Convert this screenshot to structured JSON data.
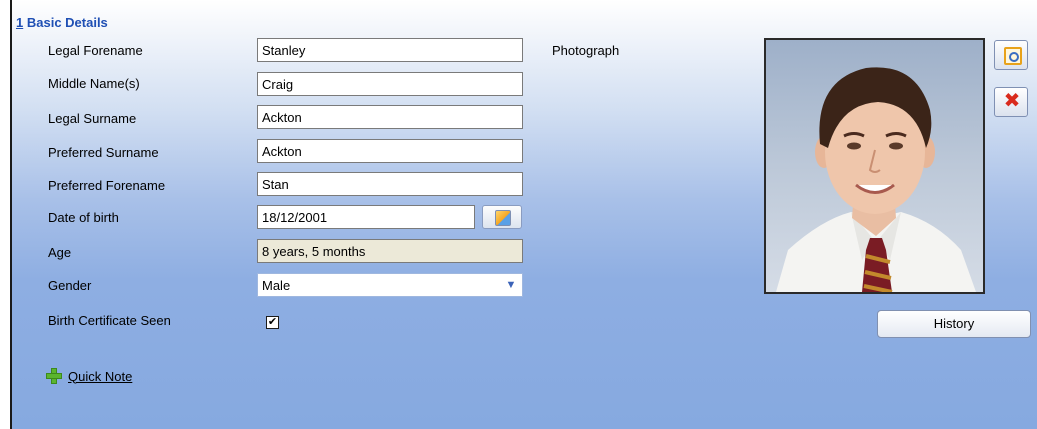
{
  "section": {
    "number": "1",
    "title": "Basic Details"
  },
  "fields": {
    "legal_forename": {
      "label": "Legal Forename",
      "value": "Stanley"
    },
    "middle_names": {
      "label": "Middle Name(s)",
      "value": "Craig"
    },
    "legal_surname": {
      "label": "Legal Surname",
      "value": "Ackton"
    },
    "preferred_surname": {
      "label": "Preferred Surname",
      "value": "Ackton"
    },
    "preferred_forename": {
      "label": "Preferred Forename",
      "value": "Stan"
    },
    "date_of_birth": {
      "label": "Date of birth",
      "value": "18/12/2001"
    },
    "age": {
      "label": "Age",
      "value": "8 years, 5 months"
    },
    "gender": {
      "label": "Gender",
      "value": "Male"
    },
    "birth_certificate": {
      "label": "Birth Certificate Seen",
      "checked": true,
      "mark": "✔"
    }
  },
  "quick_note": {
    "label": "Quick Note"
  },
  "photo": {
    "label": "Photograph"
  },
  "history_button": {
    "label": "History"
  },
  "icons": {
    "calendar": "calendar-icon",
    "browse_photo": "browse-photo-icon",
    "remove_photo": "delete-x-icon",
    "dropdown": "chevron-down-icon",
    "add": "plus-icon"
  },
  "colors": {
    "section_title": "#1f4fb4",
    "accent": "#86a9e0"
  }
}
